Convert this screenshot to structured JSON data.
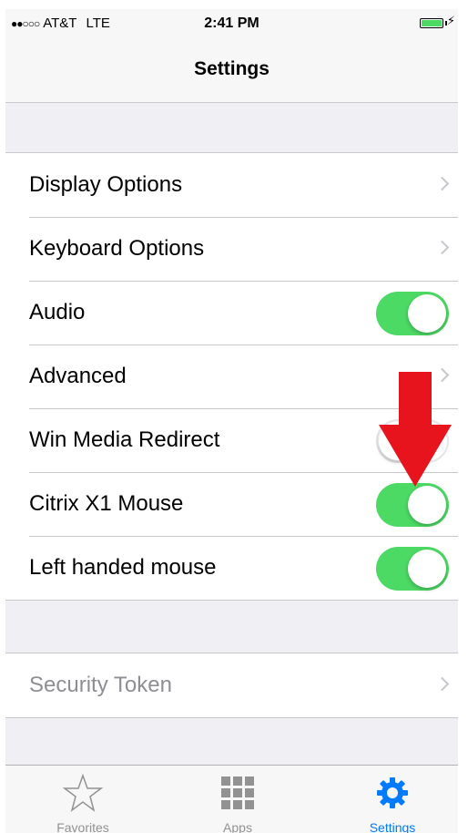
{
  "status_bar": {
    "signal": "●●○○○",
    "carrier": "AT&T",
    "network": "LTE",
    "time": "2:41 PM"
  },
  "nav": {
    "title": "Settings"
  },
  "settings_rows": [
    {
      "label": "Display Options",
      "control": "chevron"
    },
    {
      "label": "Keyboard Options",
      "control": "chevron"
    },
    {
      "label": "Audio",
      "control": "toggle",
      "on": true
    },
    {
      "label": "Advanced",
      "control": "chevron"
    },
    {
      "label": "Win Media Redirect",
      "control": "toggle",
      "on": false
    },
    {
      "label": "Citrix X1 Mouse",
      "control": "toggle",
      "on": true
    },
    {
      "label": "Left handed mouse",
      "control": "toggle",
      "on": true
    }
  ],
  "security_row": {
    "label": "Security Token",
    "control": "chevron",
    "disabled": true
  },
  "tab_bar": {
    "tabs": [
      {
        "label": "Favorites",
        "icon": "star-icon",
        "active": false
      },
      {
        "label": "Apps",
        "icon": "grid-icon",
        "active": false
      },
      {
        "label": "Settings",
        "icon": "gear-icon",
        "active": true
      }
    ]
  },
  "colors": {
    "toggle_on": "#4cd964",
    "accent": "#007aff",
    "annotation_arrow": "#e8141d",
    "battery": "#4cd964"
  }
}
